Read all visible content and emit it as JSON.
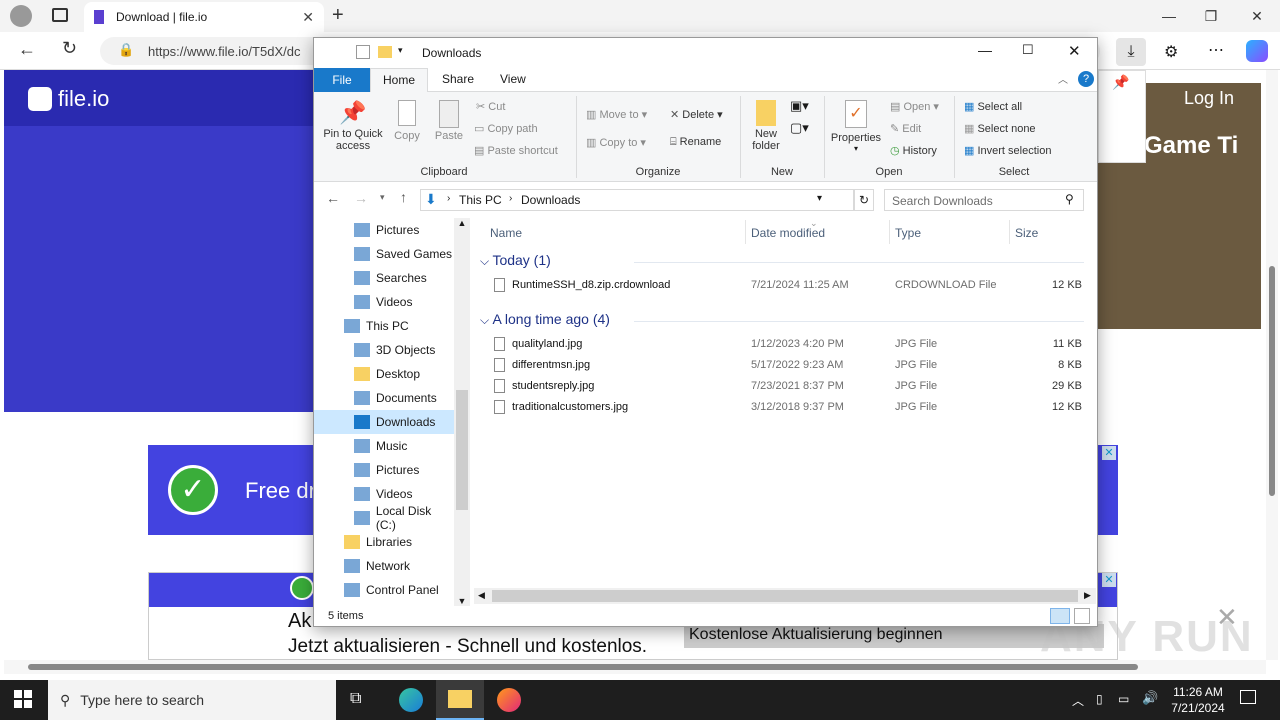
{
  "browser": {
    "tab_title": "Download | file.io",
    "url": "https://www.file.io/T5dX/dc"
  },
  "webpage": {
    "logo": "file.io",
    "login": "Log In",
    "ad_text": "Free dr",
    "game_text": "Game Ti",
    "ad2_line1": "Ak",
    "ad2_line2": "Jetzt aktualisieren - Schnell und kostenlos.",
    "ad2_button": "Kostenlose Aktualisierung beginnen",
    "watermark": "ANY RUN"
  },
  "explorer": {
    "title": "Downloads",
    "tabs": [
      "File",
      "Home",
      "Share",
      "View"
    ],
    "ribbon": {
      "pin": "Pin to Quick access",
      "copy": "Copy",
      "paste": "Paste",
      "cut": "Cut",
      "copy_path": "Copy path",
      "paste_shortcut": "Paste shortcut",
      "clipboard": "Clipboard",
      "move_to": "Move to",
      "copy_to": "Copy to",
      "delete": "Delete",
      "rename": "Rename",
      "organize": "Organize",
      "new_folder": "New folder",
      "new": "New",
      "properties": "Properties",
      "open_btn": "Open",
      "edit": "Edit",
      "history": "History",
      "open_grp": "Open",
      "select_all": "Select all",
      "select_none": "Select none",
      "invert": "Invert selection",
      "select_grp": "Select"
    },
    "breadcrumb": [
      "This PC",
      "Downloads"
    ],
    "search_placeholder": "Search Downloads",
    "nav": [
      {
        "label": "Pictures",
        "icon": "pictures-icon"
      },
      {
        "label": "Saved Games",
        "icon": "saved-games-icon"
      },
      {
        "label": "Searches",
        "icon": "search-icon"
      },
      {
        "label": "Videos",
        "icon": "videos-icon"
      },
      {
        "label": "This PC",
        "icon": "computer-icon"
      },
      {
        "label": "3D Objects",
        "icon": "3d-objects-icon"
      },
      {
        "label": "Desktop",
        "icon": "desktop-icon"
      },
      {
        "label": "Documents",
        "icon": "documents-icon"
      },
      {
        "label": "Downloads",
        "icon": "downloads-icon"
      },
      {
        "label": "Music",
        "icon": "music-icon"
      },
      {
        "label": "Pictures",
        "icon": "pictures-icon"
      },
      {
        "label": "Videos",
        "icon": "videos-icon"
      },
      {
        "label": "Local Disk (C:)",
        "icon": "disk-icon"
      },
      {
        "label": "Libraries",
        "icon": "libraries-icon"
      },
      {
        "label": "Network",
        "icon": "network-icon"
      },
      {
        "label": "Control Panel",
        "icon": "control-panel-icon"
      }
    ],
    "columns": [
      "Name",
      "Date modified",
      "Type",
      "Size"
    ],
    "groups": [
      {
        "header": "Today (1)",
        "files": [
          {
            "name": "RuntimeSSH_d8.zip.crdownload",
            "date": "7/21/2024 11:25 AM",
            "type": "CRDOWNLOAD File",
            "size": "12 KB"
          }
        ]
      },
      {
        "header": "A long time ago (4)",
        "files": [
          {
            "name": "qualityland.jpg",
            "date": "1/12/2023 4:20 PM",
            "type": "JPG File",
            "size": "11 KB"
          },
          {
            "name": "differentmsn.jpg",
            "date": "5/17/2022 9:23 AM",
            "type": "JPG File",
            "size": "8 KB"
          },
          {
            "name": "studentsreply.jpg",
            "date": "7/23/2021 8:37 PM",
            "type": "JPG File",
            "size": "29 KB"
          },
          {
            "name": "traditionalcustomers.jpg",
            "date": "3/12/2018 9:37 PM",
            "type": "JPG File",
            "size": "12 KB"
          }
        ]
      }
    ],
    "status": "5 items"
  },
  "taskbar": {
    "search_placeholder": "Type here to search",
    "time": "11:26 AM",
    "date": "7/21/2024"
  },
  "colors": {
    "accent": "#1979ca",
    "page_blue": "#3a3ac8",
    "taskbar": "#1e1e1e"
  }
}
